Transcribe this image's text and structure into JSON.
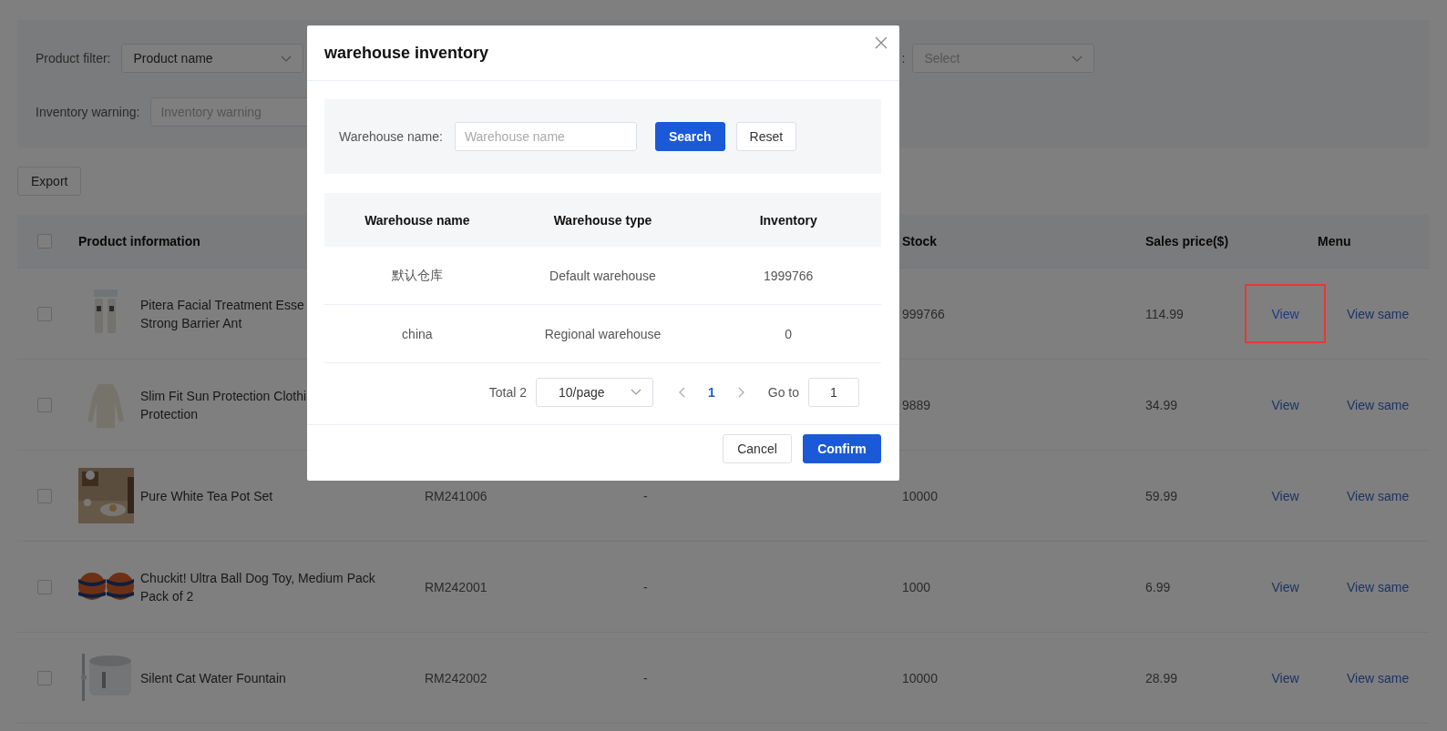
{
  "filter_panel": {
    "product_filter": {
      "label": "Product filter:",
      "value": "Product name"
    },
    "label_2": ":",
    "select_2": {
      "placeholder": "Select"
    },
    "inventory_warning": {
      "label": "Inventory warning:",
      "placeholder": "Inventory warning"
    }
  },
  "toolbar": {
    "buttons": [
      "Export"
    ]
  },
  "table": {
    "select_all": {
      "checked": false
    },
    "columns": [
      {
        "kind": "product",
        "label": "Product information"
      },
      {
        "kind": "column_2"
      },
      {
        "kind": "column_3"
      },
      {
        "kind": "stock",
        "label": "Stock"
      },
      {
        "kind": "price",
        "label": "Sales price($)"
      },
      {
        "kind": "menu",
        "label": "Menu"
      }
    ],
    "rows": [
      {
        "checked": false,
        "name_lines": [
          "Pitera Facial Treatment Esse",
          "Strong Barrier Ant"
        ],
        "stock": "999766",
        "price": "114.99",
        "actions": [
          {
            "label": "View",
            "highlighted": true
          },
          {
            "label": "View same",
            "highlighted": false
          }
        ]
      },
      {
        "checked": false,
        "name_lines": [
          "Slim Fit Sun Protection Clothi",
          "Protection"
        ],
        "stock": "9889",
        "price": "34.99",
        "actions": [
          {
            "label": "View",
            "highlighted": false
          },
          {
            "label": "View same",
            "highlighted": false
          }
        ]
      },
      {
        "checked": false,
        "name_lines": [
          "Pure White Tea Pot Set"
        ],
        "column_2": "RM241006",
        "column_3": "-",
        "stock": "10000",
        "price": "59.99",
        "actions": [
          {
            "label": "View",
            "highlighted": false
          },
          {
            "label": "View same",
            "highlighted": false
          }
        ]
      },
      {
        "checked": false,
        "name_lines": [
          "Chuckit! Ultra Ball Dog Toy, Medium Pack",
          "Pack of 2"
        ],
        "column_2": "RM242001",
        "column_3": "-",
        "stock": "1000",
        "price": "6.99",
        "actions": [
          {
            "label": "View",
            "highlighted": false
          },
          {
            "label": "View same",
            "highlighted": false
          }
        ]
      },
      {
        "checked": false,
        "name_lines": [
          "Silent Cat Water Fountain"
        ],
        "column_2": "RM242002",
        "column_3": "-",
        "stock": "10000",
        "price": "28.99",
        "actions": [
          {
            "label": "View",
            "highlighted": false
          },
          {
            "label": "View same",
            "highlighted": false
          }
        ]
      }
    ]
  },
  "modal": {
    "title": "warehouse inventory",
    "search": {
      "label": "Warehouse name:",
      "placeholder": "Warehouse name",
      "buttons": [
        {
          "label": "Search",
          "kind": "primary"
        },
        {
          "label": "Reset",
          "kind": "default"
        }
      ]
    },
    "table": {
      "columns": [
        "Warehouse name",
        "Warehouse type",
        "Inventory"
      ],
      "rows": [
        [
          "默认仓库",
          "Default warehouse",
          "1999766"
        ],
        [
          "china",
          "Regional warehouse",
          "0"
        ]
      ]
    },
    "pagination": {
      "total": "Total 2",
      "page_size": "10/page",
      "pages": [
        {
          "label": "1",
          "selected": true
        }
      ],
      "goto_label": "Go to",
      "goto_value": "1"
    },
    "buttons": [
      {
        "label": "Cancel",
        "kind": "default"
      },
      {
        "label": "Confirm",
        "kind": "primary"
      }
    ]
  }
}
